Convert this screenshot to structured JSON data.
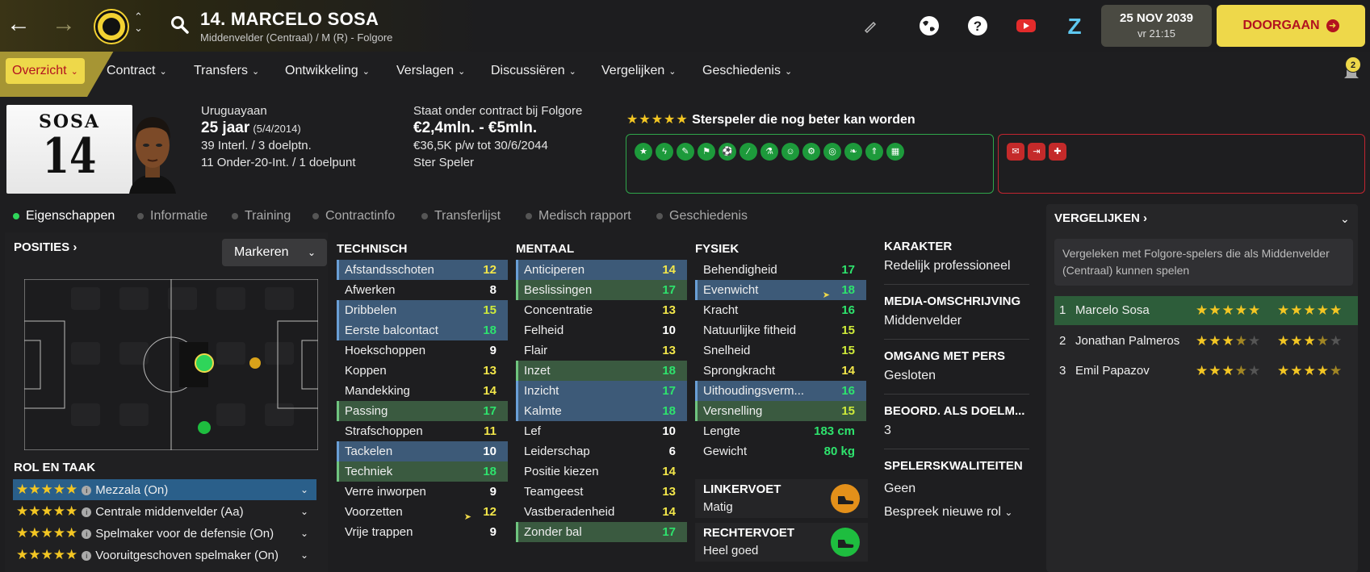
{
  "header": {
    "title": "14. MARCELO SOSA",
    "subtitle": "Middenvelder (Centraal) / M (R) - Folgore",
    "date": "25 NOV 2039",
    "time": "vr 21:15",
    "continue_label": "DOORGAAN"
  },
  "menu": {
    "items": [
      "Overzicht",
      "Contract",
      "Transfers",
      "Ontwikkeling",
      "Verslagen",
      "Discussiëren",
      "Vergelijken",
      "Geschiedenis"
    ],
    "notification_count": "2"
  },
  "kit": {
    "name": "SOSA",
    "number": "14"
  },
  "info": {
    "nationality": "Uruguayaan",
    "age": "25 jaar",
    "dob": "(5/4/2014)",
    "caps": "39 Interl. / 3 doelptn.",
    "u20": "11 Onder-20-Int. / 1 doelpunt",
    "contract_line": "Staat onder contract bij Folgore",
    "value": "€2,4mln. - €5mln.",
    "wage": "€36,5K p/w tot 30/6/2044",
    "status": "Ster Speler",
    "stars": "★★★★★",
    "star_label": "Sterspeler die nog beter kan worden"
  },
  "subtabs": [
    "Eigenschappen",
    "Informatie",
    "Training",
    "Contractinfo",
    "Transferlijst",
    "Medisch rapport",
    "Geschiedenis"
  ],
  "positions": {
    "title": "POSITIES",
    "dropdown": "Markeren"
  },
  "roles": {
    "title": "ROL EN TAAK",
    "items": [
      {
        "stars": "★★★★★",
        "label": "Mezzala (On)"
      },
      {
        "stars": "★★★★★",
        "label": "Centrale middenvelder (Aa)"
      },
      {
        "stars": "★★★★★",
        "label": "Spelmaker voor de defensie (On)"
      },
      {
        "stars": "★★★★★",
        "label": "Vooruitgeschoven spelmaker (On)"
      }
    ]
  },
  "technisch": {
    "title": "TECHNISCH",
    "rows": [
      {
        "name": "Afstandsschoten",
        "value": "12"
      },
      {
        "name": "Afwerken",
        "value": "8"
      },
      {
        "name": "Dribbelen",
        "value": "15"
      },
      {
        "name": "Eerste balcontact",
        "value": "18"
      },
      {
        "name": "Hoekschoppen",
        "value": "9"
      },
      {
        "name": "Koppen",
        "value": "13"
      },
      {
        "name": "Mandekking",
        "value": "14"
      },
      {
        "name": "Passing",
        "value": "17"
      },
      {
        "name": "Strafschoppen",
        "value": "11"
      },
      {
        "name": "Tackelen",
        "value": "10"
      },
      {
        "name": "Techniek",
        "value": "18"
      },
      {
        "name": "Verre inworpen",
        "value": "9"
      },
      {
        "name": "Voorzetten",
        "value": "12"
      },
      {
        "name": "Vrije trappen",
        "value": "9"
      }
    ]
  },
  "mentaal": {
    "title": "MENTAAL",
    "rows": [
      {
        "name": "Anticiperen",
        "value": "14"
      },
      {
        "name": "Beslissingen",
        "value": "17"
      },
      {
        "name": "Concentratie",
        "value": "13"
      },
      {
        "name": "Felheid",
        "value": "10"
      },
      {
        "name": "Flair",
        "value": "13"
      },
      {
        "name": "Inzet",
        "value": "18"
      },
      {
        "name": "Inzicht",
        "value": "17"
      },
      {
        "name": "Kalmte",
        "value": "18"
      },
      {
        "name": "Lef",
        "value": "10"
      },
      {
        "name": "Leiderschap",
        "value": "6"
      },
      {
        "name": "Positie kiezen",
        "value": "14"
      },
      {
        "name": "Teamgeest",
        "value": "13"
      },
      {
        "name": "Vastberadenheid",
        "value": "14"
      },
      {
        "name": "Zonder bal",
        "value": "17"
      }
    ]
  },
  "fysiek": {
    "title": "FYSIEK",
    "rows": [
      {
        "name": "Behendigheid",
        "value": "17"
      },
      {
        "name": "Evenwicht",
        "value": "18"
      },
      {
        "name": "Kracht",
        "value": "16"
      },
      {
        "name": "Natuurlijke fitheid",
        "value": "15"
      },
      {
        "name": "Snelheid",
        "value": "15"
      },
      {
        "name": "Sprongkracht",
        "value": "14"
      },
      {
        "name": "Uithoudingsverm...",
        "value": "16"
      },
      {
        "name": "Versnelling",
        "value": "15"
      },
      {
        "name": "Lengte",
        "value": "183 cm"
      },
      {
        "name": "Gewicht",
        "value": "80 kg"
      }
    ],
    "left_foot_label": "LINKERVOET",
    "left_foot_value": "Matig",
    "right_foot_label": "RECHTERVOET",
    "right_foot_value": "Heel goed"
  },
  "karakter": {
    "h1": "KARAKTER",
    "v1": "Redelijk professioneel",
    "h2": "MEDIA-OMSCHRIJVING",
    "v2": "Middenvelder",
    "h3": "OMGANG MET PERS",
    "v3": "Gesloten",
    "h4": "BEOORD. ALS DOELM...",
    "v4": "3",
    "h5": "SPELERSKWALITEITEN",
    "v5": "Geen",
    "link": "Bespreek nieuwe rol"
  },
  "compare": {
    "title": "VERGELIJKEN",
    "desc": "Vergeleken met Folgore-spelers die als Middenvelder (Centraal) kunnen spelen",
    "rows": [
      {
        "rank": "1",
        "name": "Marcelo Sosa",
        "ca": "★★★★★",
        "pa": "★★★★★"
      },
      {
        "rank": "2",
        "name": "Jonathan Palmeros",
        "ca": "★★★",
        "pa": "★★★"
      },
      {
        "rank": "3",
        "name": "Emil Papazov",
        "ca": "★★★",
        "pa": "★★★★"
      }
    ]
  }
}
